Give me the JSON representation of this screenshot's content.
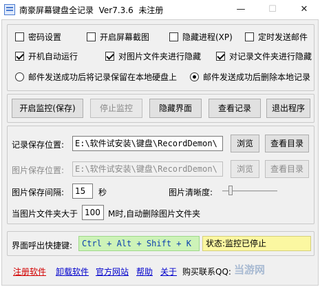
{
  "window": {
    "title": "南豪屏幕键盘全记录  Ver7.3.6  未注册",
    "minimize_glyph": "—",
    "maximize_glyph": "☐",
    "close_glyph": "✕"
  },
  "options": {
    "password_setting": "密码设置",
    "screen_capture": "开启屏幕截图",
    "hide_process": "隐藏进程(XP)",
    "scheduled_mail": "定时发送邮件",
    "auto_start": "开机自动运行",
    "hide_image_folder": "对图片文件夹进行隐藏",
    "hide_record_folder": "对记录文件夹进行隐藏",
    "radio_keep_local": "邮件发送成功后将记录保留在本地硬盘上",
    "radio_delete_local": "邮件发送成功后删除本地记录"
  },
  "buttons": {
    "start_monitor": "开启监控(保存)",
    "stop_monitor": "停止监控",
    "hide_ui": "隐藏界面",
    "view_records": "查看记录",
    "exit": "退出程序",
    "browse": "浏览",
    "view_dir": "查看目录"
  },
  "record_path": {
    "label": "记录保存位置:",
    "value": "E:\\软件试安装\\键盘\\RecordDemon\\"
  },
  "image_path": {
    "label": "图片保存位置:",
    "value": "E:\\软件试安装\\键盘\\RecordDemon\\"
  },
  "image_interval": {
    "label": "图片保存间隔:",
    "value": "15",
    "unit": "秒"
  },
  "image_quality": {
    "label": "图片清晰度:",
    "level": 0.12
  },
  "folder_limit": {
    "prefix": "当图片文件夹大于",
    "value": "100",
    "suffix": "M时,自动删除图片文件夹"
  },
  "hotkey": {
    "label": "界面呼出快捷键:",
    "value": "Ctrl + Alt + Shift + K"
  },
  "status": {
    "value": "状态:监控已停止"
  },
  "footer": {
    "register": "注册软件",
    "uninstall": "卸载软件",
    "website": "官方网站",
    "help": "帮助",
    "about": "关于",
    "qq_label": "购买联系QQ:"
  },
  "watermark": "当游网",
  "colors": {
    "link": "#0000cc",
    "register_link": "#d20000",
    "hotkey_bg": "#cdf3b8",
    "status_bg": "#fbf7a1",
    "hotkey_text": "#0a3fae"
  }
}
